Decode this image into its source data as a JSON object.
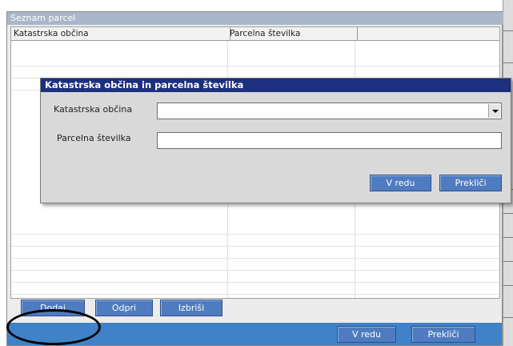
{
  "main_window": {
    "title": "Seznam parcel",
    "columns": [
      "Katastrska občina",
      "Parcelna številka",
      ""
    ],
    "buttons": {
      "add": "Dodaj",
      "open": "Odpri",
      "delete": "Izbriši",
      "ok": "V redu",
      "cancel": "Prekliči"
    }
  },
  "dialog": {
    "title": "Katastrska občina in parcelna številka",
    "fields": {
      "cadastral_label": "Katastrska občina",
      "cadastral_value": "",
      "parcel_label": "Parcelna številka",
      "parcel_value": ""
    },
    "buttons": {
      "ok": "V redu",
      "cancel": "Prekliči"
    }
  },
  "colors": {
    "button_blue": "#4f7cc0",
    "dialog_title": "#1d2f7f",
    "bottom_bar": "#3f82c7"
  }
}
